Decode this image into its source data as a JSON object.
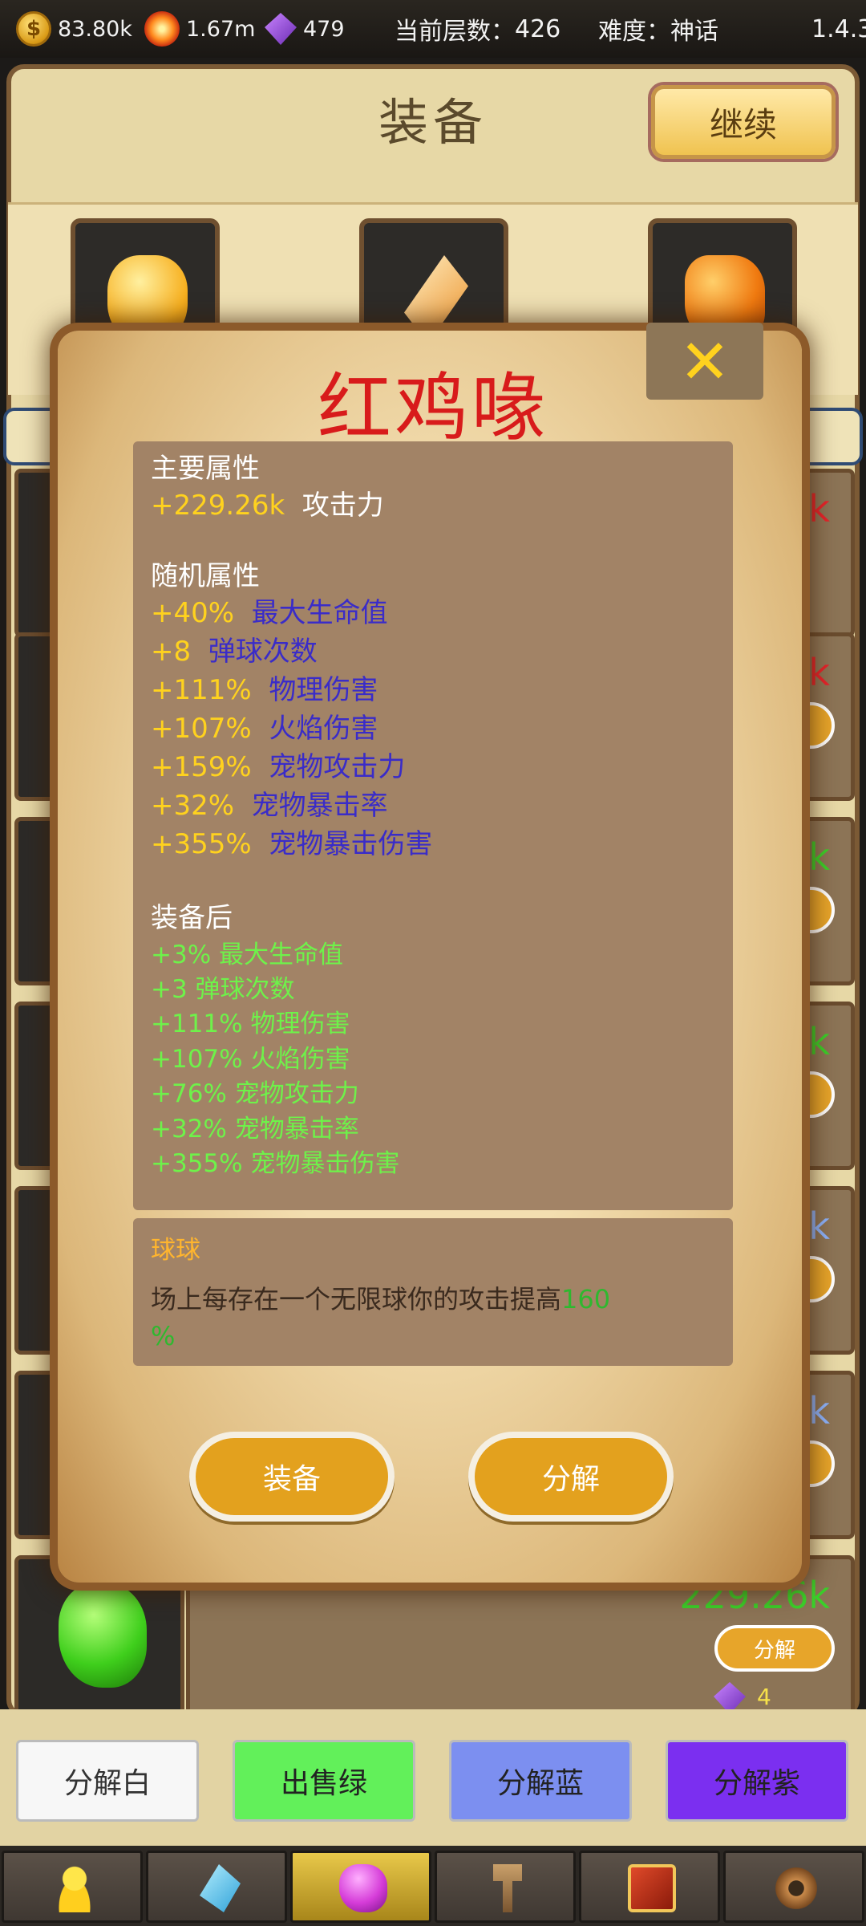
{
  "topbar": {
    "gold": "83.80k",
    "fire": "1.67m",
    "gems": "479",
    "floor_label": "当前层数：",
    "floor_value": "426",
    "difficulty_label": "难度：",
    "difficulty_value": "神话",
    "version": "1.4.3"
  },
  "panel": {
    "title": "装备",
    "continue_label": "继续"
  },
  "rows": [
    {
      "value": "26k",
      "color": "#e8232b"
    },
    {
      "value": "6k",
      "color": "#3bd12a"
    },
    {
      "value": "6k",
      "color": "#3bd12a"
    },
    {
      "value": "26k",
      "color": "#8cb4ff"
    },
    {
      "value": "26k",
      "color": "#8cb4ff"
    },
    {
      "value": "229.26k",
      "color": "#3bd12a",
      "button": "分解",
      "gem_count": "4"
    }
  ],
  "popup": {
    "title": "红鸡喙",
    "main_header": "主要属性",
    "main_value": "+229.26k",
    "main_name": "攻击力",
    "random_header": "随机属性",
    "random": [
      {
        "value": "+40%",
        "name": "最大生命值"
      },
      {
        "value": "+8",
        "name": "弹球次数"
      },
      {
        "value": "+111%",
        "name": "物理伤害"
      },
      {
        "value": "+107%",
        "name": "火焰伤害"
      },
      {
        "value": "+159%",
        "name": "宠物攻击力"
      },
      {
        "value": "+32%",
        "name": "宠物暴击率"
      },
      {
        "value": "+355%",
        "name": "宠物暴击伤害"
      }
    ],
    "after_header": "装备后",
    "after": [
      "+3% 最大生命值",
      "+3 弹球次数",
      "+111% 物理伤害",
      "+107% 火焰伤害",
      "+76% 宠物攻击力",
      "+32% 宠物暴击率",
      "+355% 宠物暴击伤害"
    ],
    "skill_name": "球球",
    "skill_desc": "场上每存在一个无限球你的攻击提高",
    "skill_num": "160",
    "skill_suffix": "%",
    "equip_button": "装备",
    "dismantle_button": "分解"
  },
  "filters": {
    "white": "分解白",
    "green": "出售绿",
    "blue": "分解蓝",
    "purple": "分解紫"
  },
  "nav": {
    "icons": [
      "hero-icon",
      "rune-icon",
      "equipment-icon",
      "forge-icon",
      "book-icon",
      "settings-gear-icon"
    ],
    "active_index": 2
  }
}
